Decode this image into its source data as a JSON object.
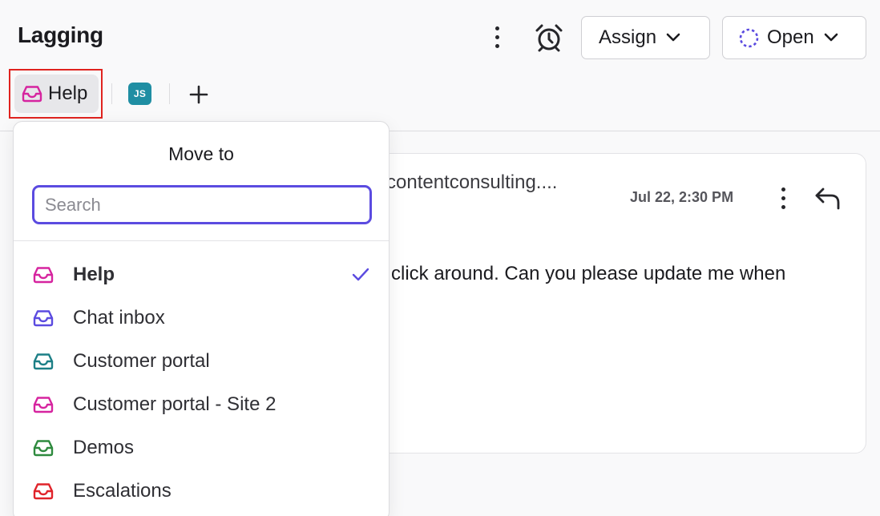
{
  "header": {
    "title": "Lagging",
    "assign_label": "Assign",
    "status_label": "Open"
  },
  "tags": {
    "inbox_label": "Help",
    "avatar_initials": "JS"
  },
  "message": {
    "sender": "contentconsulting....",
    "time": "Jul 22, 2:30 PM",
    "body": "click around. Can you please update me when"
  },
  "dropdown": {
    "title": "Move to",
    "search_placeholder": "Search",
    "items": [
      {
        "label": "Help",
        "icon": "inbox-icon",
        "color": "#d6249f",
        "selected": true
      },
      {
        "label": "Chat inbox",
        "icon": "inbox-icon",
        "color": "#5b4be0",
        "selected": false
      },
      {
        "label": "Customer portal",
        "icon": "inbox-icon",
        "color": "#1c7f86",
        "selected": false
      },
      {
        "label": "Customer portal - Site 2",
        "icon": "inbox-icon",
        "color": "#d6249f",
        "selected": false
      },
      {
        "label": "Demos",
        "icon": "inbox-icon",
        "color": "#2e8a3e",
        "selected": false
      },
      {
        "label": "Escalations",
        "icon": "inbox-icon",
        "color": "#e0232a",
        "selected": false
      }
    ]
  },
  "colors": {
    "accent": "#5b4be0",
    "highlight": "#e0231f",
    "avatar": "#1f8ea3"
  }
}
